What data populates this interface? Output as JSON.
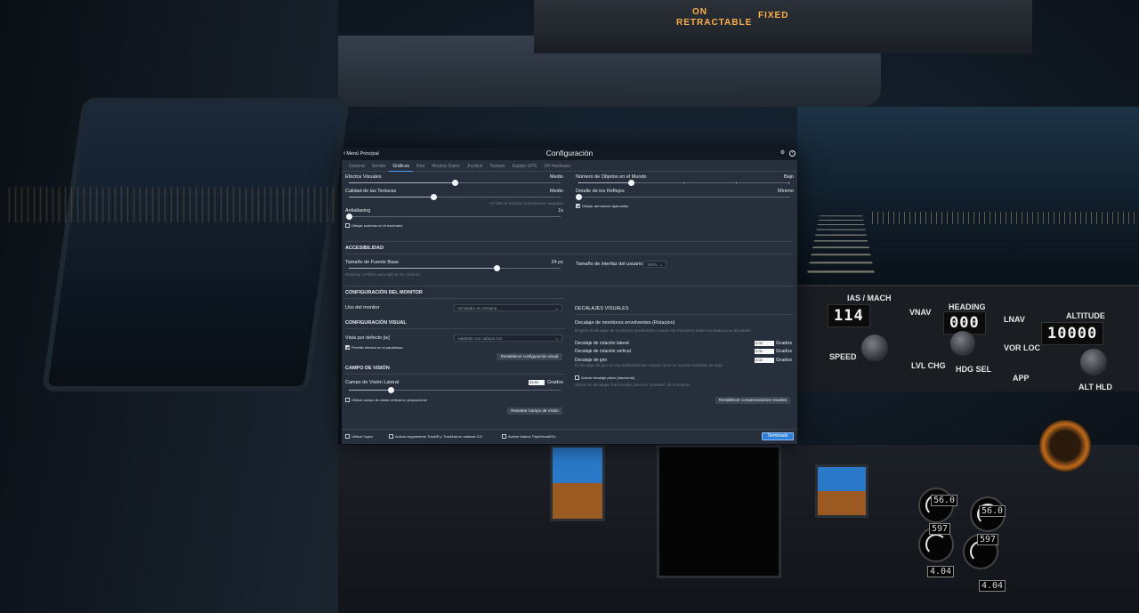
{
  "background": {
    "overhead": {
      "text_left": "RETRACTABLE",
      "text_right": "FIXED",
      "text_on": "ON"
    },
    "mcp": {
      "ias_label": "IAS / MACH",
      "ias_value": "114",
      "heading_label": "HEADING",
      "heading_value": "000",
      "altitude_label": "ALTITUDE",
      "altitude_value": "10000",
      "buttons": [
        "VNAV",
        "LNAV",
        "VOR LOC",
        "APP",
        "ALT HLD",
        "HDG SEL",
        "LVL CHG",
        "SPEED"
      ]
    },
    "engine": {
      "n1_left": "56.0",
      "n1_right": "56.0",
      "egt_left": "597",
      "egt_right": "597",
      "ff_left": "4.04",
      "ff_right": "4.04"
    }
  },
  "dialog": {
    "back_label": "Menú Principal",
    "title": "Configuración",
    "tabs": [
      "General",
      "Sonido",
      "Gráficos",
      "Red",
      "Mostrar Datos",
      "Joystick",
      "Teclado",
      "Equipo GPS",
      "VR Hardware"
    ],
    "active_tab": "Gráficos",
    "left": {
      "visual_effects": {
        "label": "Efectos Visuales",
        "value": "Medio",
        "level": 0.5
      },
      "texture_quality": {
        "label": "Calidad de las Texturas",
        "value": "Medio",
        "level": 0.4,
        "note": "67 MB de texturas actualmente cargadas"
      },
      "antialiasing": {
        "label": "Antialiasing",
        "value": "1x",
        "level": 0.0
      },
      "draw_shadows": {
        "label": "Dibujar sombras en el escenario",
        "checked": false
      }
    },
    "right": {
      "world_objects": {
        "label": "Número de Objetos en el Mundo",
        "value": "Bajo",
        "level": 0.25
      },
      "reflections": {
        "label": "Detalle de los Reflejos",
        "value": "Mínimo",
        "level": 0.0
      },
      "parked_aircraft": {
        "label": "Dibujar aeronaves aparcadas",
        "checked": true
      }
    },
    "accessibility": {
      "section": "ACCESIBILIDAD",
      "font_size": {
        "label": "Tamaño de Fuente Base",
        "value": "24 px",
        "level": 0.7,
        "note": "Reiniciar X-Plane para aplicar los cambios"
      },
      "ui_size": {
        "label": "Tamaño de interfaz del usuario",
        "value": "100%"
      }
    },
    "monitor": {
      "section": "CONFIGURACIÓN DEL MONITOR",
      "usage_label": "Uso del monitor",
      "usage_value": "Simulador en Ventana",
      "visual_section": "CONFIGURACIÓN VISUAL",
      "default_view_label": "Vista por defecto [w]",
      "default_view_value": "Adelante con cabeza 3-D",
      "windshield_effects": {
        "label": "Permitir efectos en el parabrisas",
        "checked": true
      },
      "reset_visual": "Restablecer configuración visual"
    },
    "fov": {
      "section": "CAMPO DE VISIÓN",
      "lateral_label": "Campo de Visión Lateral",
      "lateral_value": "53.50",
      "lateral_unit": "Grados",
      "level": 0.2,
      "nonprop": {
        "label": "Utilizar campo de visión vertical no proporcional",
        "checked": false
      },
      "reset": "Resetear Campo de Visión"
    },
    "offsets": {
      "section": "DECALAJES VISUALES",
      "wrap_title": "Decalaje de monitores envolventes (Rotacion)",
      "wrap_desc": "Emplee el decalaje de monitores envolventes cuando los monitores estén montados a su alrededor.",
      "lateral": {
        "label": "Decalaje de rotación lateral",
        "value": "0.00",
        "unit": "Grados"
      },
      "vertical": {
        "label": "Decalaje de rotación vertical",
        "value": "0.00",
        "unit": "Grados"
      },
      "roll": {
        "label": "Decalaje de giro",
        "value": "0.00",
        "unit": "Grados",
        "note": "El decalaje de giro se usa habitualmente cuando tiene un monitor tumbado de lado."
      },
      "flat": {
        "label": "Activar decalaje plano (fraccional)",
        "checked": false,
        "note": "Utilice los decalajes fraccionales para los \"paneles\" de monitores."
      },
      "reset": "Restablecer compensaciones visuales"
    },
    "footer": {
      "vsync": {
        "label": "Utilizar Vsync",
        "checked": false
      },
      "trackir": {
        "label": "Activar seguimiento TrackIR y TrackHat en cabinas 3-D",
        "checked": false
      },
      "triplehead": {
        "label": "Activar Matrox TripleHead2Go",
        "checked": false
      },
      "done": "Terminado"
    }
  }
}
